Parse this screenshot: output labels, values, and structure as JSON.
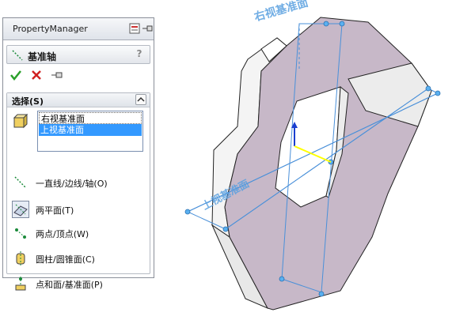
{
  "property_manager": {
    "title": "PropertyManager",
    "feature_title": "基准轴",
    "help": "?",
    "confirm_icon": "check-icon",
    "cancel_icon": "close-icon",
    "pin_icon": "pushpin-icon"
  },
  "selection": {
    "heading": "选择(S)",
    "items": [
      "右视基准面",
      "上视基准面"
    ],
    "selected_index": 1
  },
  "filters": [
    {
      "label": "一直线/边线/轴(O)",
      "icon": "line-edge-axis-icon",
      "pressed": false
    },
    {
      "label": "两平面(T)",
      "icon": "two-planes-icon",
      "pressed": true
    },
    {
      "label": "两点/顶点(W)",
      "icon": "two-points-icon",
      "pressed": false
    },
    {
      "label": "圆柱/圆锥面(C)",
      "icon": "cylinder-cone-icon",
      "pressed": false
    },
    {
      "label": "点和面/基准面(P)",
      "icon": "point-plane-icon",
      "pressed": false
    }
  ],
  "viewport": {
    "plane_label_right": "右视基准面",
    "plane_label_top": "上视基准面",
    "colors": {
      "part_face": "#c7b8c8",
      "part_side": "#f2f2f2",
      "plane_line": "#4a90d9",
      "axis_preview": "#ffff00"
    }
  }
}
